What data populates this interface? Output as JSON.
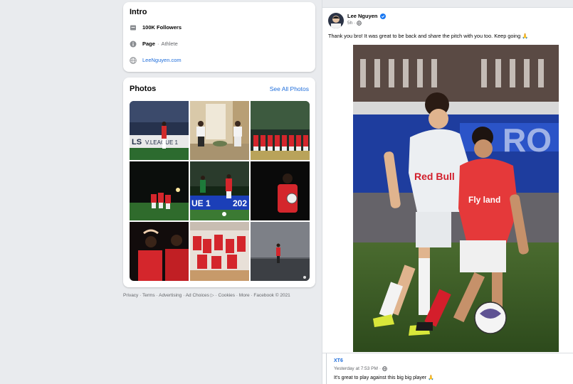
{
  "intro": {
    "title": "Intro",
    "followers": "100K Followers",
    "page_label": "Page",
    "page_category": "Athlete",
    "website": "LeeNguyen.com"
  },
  "photos": {
    "title": "Photos",
    "see_all": "See All Photos",
    "items": [
      {
        "icon": "stadium-photo"
      },
      {
        "icon": "living-room-photo"
      },
      {
        "icon": "team-lineup-photo"
      },
      {
        "icon": "night-celebration-photo"
      },
      {
        "icon": "match-action-photo"
      },
      {
        "icon": "player-with-ball-photo"
      },
      {
        "icon": "heart-gesture-photo"
      },
      {
        "icon": "locker-room-photo"
      },
      {
        "icon": "lone-player-photo"
      }
    ]
  },
  "footer": {
    "privacy": "Privacy",
    "terms": "Terms",
    "advertising": "Advertising",
    "ad_choices": "Ad Choices",
    "cookies": "Cookies",
    "more": "More",
    "copyright": "Facebook © 2021",
    "sep": " · "
  },
  "post": {
    "author": "Lee Nguyen",
    "time": "5h",
    "text": "Thank you bro! It was great to be back and share the pitch with you too. Keep going 🙏"
  },
  "comment": {
    "author": "XT6",
    "time": "Yesterday at 7:53 PM",
    "text": "It's great to play against this big big player 🙏"
  },
  "colors": {
    "link": "#216fdb",
    "background": "#e9ebee",
    "verified": "#1877f2"
  }
}
